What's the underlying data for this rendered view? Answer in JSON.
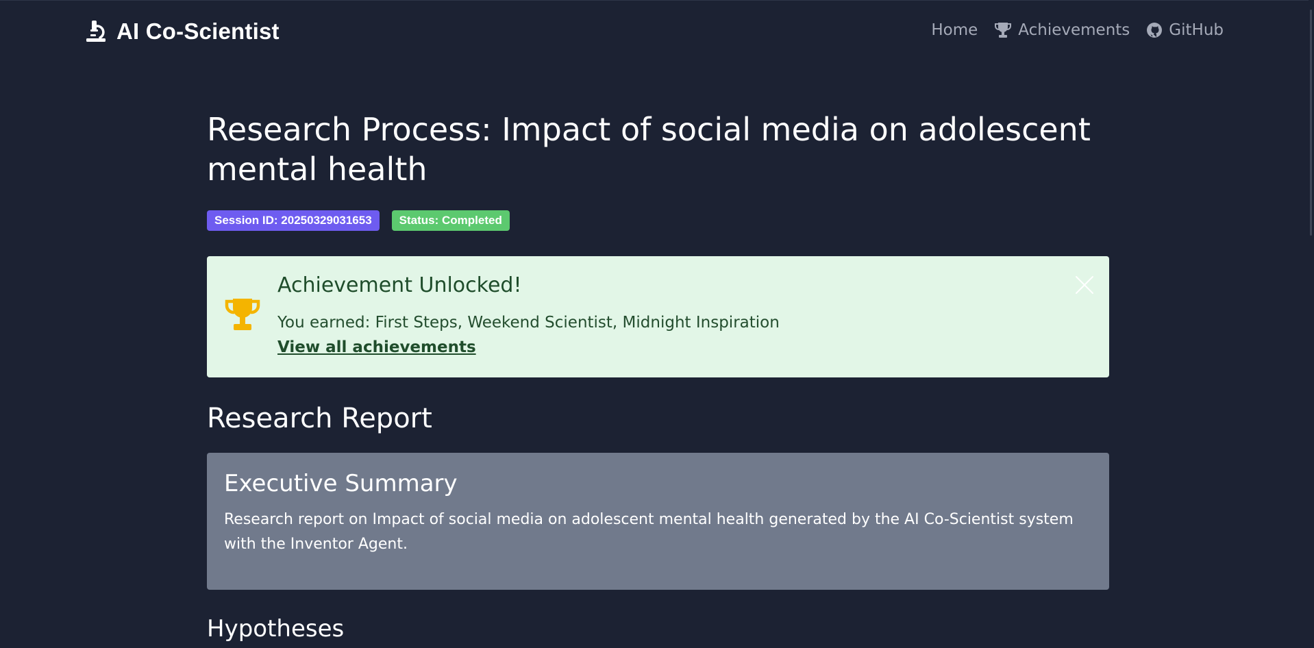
{
  "navbar": {
    "brand": "AI Co-Scientist",
    "brand_icon": "microscope-icon",
    "links": [
      {
        "label": "Home",
        "icon": ""
      },
      {
        "label": "Achievements",
        "icon": "trophy-icon"
      },
      {
        "label": "GitHub",
        "icon": "github-icon"
      }
    ]
  },
  "page": {
    "title": "Research Process: Impact of social media on adolescent mental health",
    "badges": {
      "session": "Session ID: 20250329031653",
      "status": "Status: Completed"
    }
  },
  "achievement": {
    "title": "Achievement Unlocked!",
    "text": "You earned: First Steps, Weekend Scientist, Midnight Inspiration",
    "link": "View all achievements",
    "icon": "trophy-icon",
    "close_icon": "close-icon"
  },
  "report": {
    "title": "Research Report",
    "summary": {
      "title": "Executive Summary",
      "text": "Research report on Impact of social media on adolescent mental health generated by the AI Co-Scientist system with the Inventor Agent."
    },
    "hypotheses_title": "Hypotheses"
  },
  "colors": {
    "background": "#1c2233",
    "badge_session": "#6e5cf0",
    "badge_status": "#5cc96f",
    "achievement_bg": "#e2f6e7",
    "trophy": "#f4b400",
    "summary_bg": "#717a8c"
  }
}
